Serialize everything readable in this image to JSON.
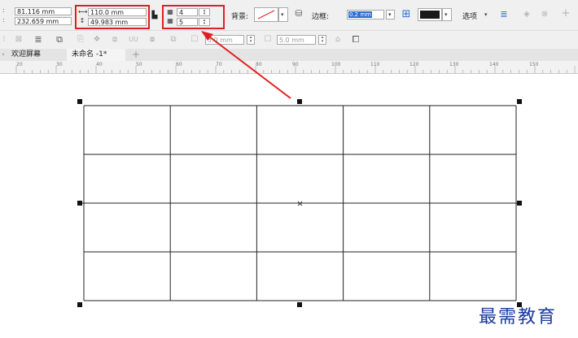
{
  "property_bar": {
    "position": {
      "x": "81.116 mm",
      "y": "232.659 mm"
    },
    "size": {
      "width": "110.0 mm",
      "height": "49.983 mm"
    },
    "table": {
      "columns": "4",
      "rows": "5"
    },
    "background_label": "背景:",
    "border_label": "边框:",
    "border_width": "0.2 mm",
    "options_label": "选项",
    "border_color": "#1a1a1a"
  },
  "toolbar2": {
    "field_a": "5.0 mm",
    "field_b": "5.0 mm"
  },
  "tabs": [
    {
      "label": "欢迎屏幕"
    },
    {
      "label": "未命名 -1*"
    }
  ],
  "add_tab_label": "+",
  "ruler": {
    "labels": [
      "20",
      "30",
      "40",
      "50",
      "60",
      "70",
      "80",
      "90",
      "100",
      "110",
      "120",
      "130",
      "140",
      "150"
    ]
  },
  "table_grid": {
    "rows": 4,
    "columns": 5
  },
  "watermark": "最需教育",
  "annotation_color": "#e02020"
}
